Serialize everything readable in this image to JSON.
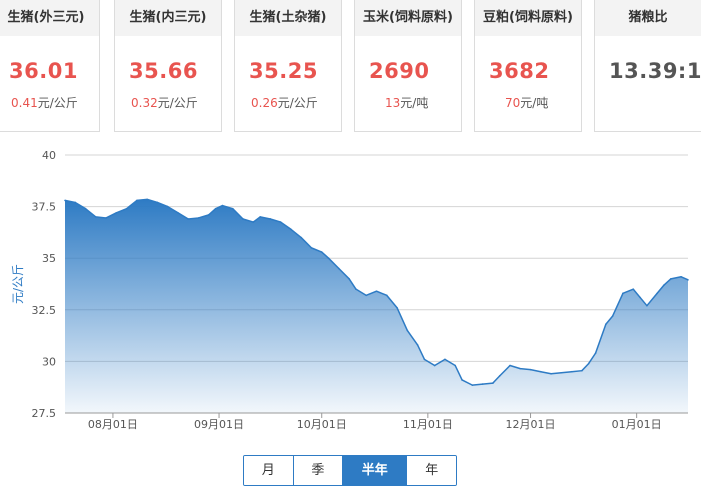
{
  "cards": [
    {
      "title": "生猪(外三元)",
      "price": "36.01",
      "change_value": "0.41",
      "change_unit": "元/公斤"
    },
    {
      "title": "生猪(内三元)",
      "price": "35.66",
      "change_value": "0.32",
      "change_unit": "元/公斤"
    },
    {
      "title": "生猪(土杂猪)",
      "price": "35.25",
      "change_value": "0.26",
      "change_unit": "元/公斤"
    },
    {
      "title": "玉米(饲料原料)",
      "price": "2690",
      "change_value": "13",
      "change_unit": "元/吨"
    },
    {
      "title": "豆粕(饲料原料)",
      "price": "3682",
      "change_value": "70",
      "change_unit": "元/吨"
    },
    {
      "title": "猪粮比",
      "price": "13.39:1",
      "change_value": "",
      "change_unit": ""
    }
  ],
  "colors": {
    "price_red": "#e8544f",
    "ratio_gray": "#555555",
    "line": "#2e7bc4",
    "accent": "#2e7bc4"
  },
  "periods": [
    {
      "label": "月",
      "active": false
    },
    {
      "label": "季",
      "active": false
    },
    {
      "label": "半年",
      "active": true
    },
    {
      "label": "年",
      "active": false
    }
  ],
  "chart_data": {
    "type": "area",
    "ylabel": "元/公斤",
    "ylim": [
      27.5,
      40
    ],
    "yticks": [
      "27.5",
      "30",
      "32.5",
      "35",
      "37.5",
      "40"
    ],
    "grid": true,
    "x_tick_labels": [
      "08月01日",
      "09月01日",
      "10月01日",
      "11月01日",
      "12月01日",
      "01月01日"
    ],
    "x_tick_dates": [
      "2023-08-01",
      "2023-09-01",
      "2023-10-01",
      "2023-11-01",
      "2023-12-01",
      "2024-01-01"
    ],
    "x_range": [
      "2023-07-18",
      "2024-01-16"
    ],
    "series": [
      {
        "points": [
          [
            "2023-07-18",
            37.8
          ],
          [
            "2023-07-21",
            37.7
          ],
          [
            "2023-07-24",
            37.4
          ],
          [
            "2023-07-27",
            37.0
          ],
          [
            "2023-07-30",
            36.95
          ],
          [
            "2023-08-02",
            37.2
          ],
          [
            "2023-08-05",
            37.4
          ],
          [
            "2023-08-08",
            37.8
          ],
          [
            "2023-08-11",
            37.85
          ],
          [
            "2023-08-14",
            37.7
          ],
          [
            "2023-08-17",
            37.5
          ],
          [
            "2023-08-20",
            37.2
          ],
          [
            "2023-08-23",
            36.9
          ],
          [
            "2023-08-26",
            36.95
          ],
          [
            "2023-08-29",
            37.1
          ],
          [
            "2023-08-31",
            37.4
          ],
          [
            "2023-09-02",
            37.55
          ],
          [
            "2023-09-05",
            37.4
          ],
          [
            "2023-09-08",
            36.9
          ],
          [
            "2023-09-11",
            36.75
          ],
          [
            "2023-09-13",
            37.0
          ],
          [
            "2023-09-16",
            36.9
          ],
          [
            "2023-09-19",
            36.75
          ],
          [
            "2023-09-22",
            36.4
          ],
          [
            "2023-09-25",
            36.0
          ],
          [
            "2023-09-28",
            35.5
          ],
          [
            "2023-10-01",
            35.3
          ],
          [
            "2023-10-03",
            35.0
          ],
          [
            "2023-10-06",
            34.5
          ],
          [
            "2023-10-09",
            34.0
          ],
          [
            "2023-10-11",
            33.5
          ],
          [
            "2023-10-14",
            33.2
          ],
          [
            "2023-10-17",
            33.4
          ],
          [
            "2023-10-20",
            33.2
          ],
          [
            "2023-10-23",
            32.6
          ],
          [
            "2023-10-26",
            31.5
          ],
          [
            "2023-10-29",
            30.8
          ],
          [
            "2023-10-31",
            30.1
          ],
          [
            "2023-11-03",
            29.8
          ],
          [
            "2023-11-06",
            30.1
          ],
          [
            "2023-11-09",
            29.8
          ],
          [
            "2023-11-11",
            29.1
          ],
          [
            "2023-11-14",
            28.85
          ],
          [
            "2023-11-17",
            28.9
          ],
          [
            "2023-11-20",
            28.95
          ],
          [
            "2023-11-22",
            29.3
          ],
          [
            "2023-11-25",
            29.8
          ],
          [
            "2023-11-28",
            29.65
          ],
          [
            "2023-12-01",
            29.6
          ],
          [
            "2023-12-04",
            29.5
          ],
          [
            "2023-12-07",
            29.4
          ],
          [
            "2023-12-10",
            29.45
          ],
          [
            "2023-12-13",
            29.5
          ],
          [
            "2023-12-16",
            29.55
          ],
          [
            "2023-12-18",
            29.9
          ],
          [
            "2023-12-20",
            30.4
          ],
          [
            "2023-12-23",
            31.8
          ],
          [
            "2023-12-25",
            32.2
          ],
          [
            "2023-12-28",
            33.3
          ],
          [
            "2023-12-31",
            33.5
          ],
          [
            "2024-01-02",
            33.1
          ],
          [
            "2024-01-04",
            32.7
          ],
          [
            "2024-01-07",
            33.3
          ],
          [
            "2024-01-09",
            33.7
          ],
          [
            "2024-01-11",
            34.0
          ],
          [
            "2024-01-14",
            34.1
          ],
          [
            "2024-01-16",
            33.95
          ]
        ]
      }
    ]
  }
}
